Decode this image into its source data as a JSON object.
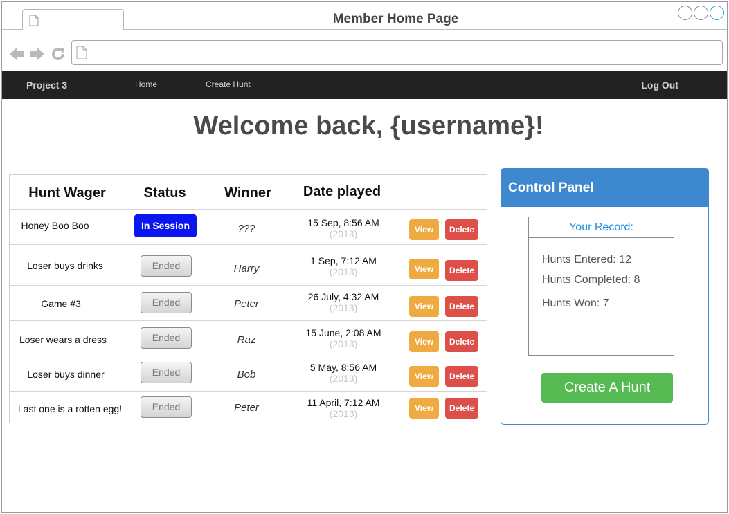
{
  "window": {
    "title": "Member Home Page"
  },
  "navbar": {
    "brand": "Project 3",
    "links": [
      "Home",
      "Create Hunt"
    ],
    "logout": "Log Out"
  },
  "welcome": "Welcome back, {username}!",
  "table": {
    "headers": [
      "Hunt Wager",
      "Status",
      "Winner",
      "Date played"
    ],
    "rows": [
      {
        "wager": "Honey Boo Boo",
        "status": "In Session",
        "winner": "???",
        "date": "15 Sep, 8:56 AM",
        "year": "(2013)"
      },
      {
        "wager": "Loser buys drinks",
        "status": "Ended",
        "winner": "Harry",
        "date": "1 Sep, 7:12 AM",
        "year": "(2013)"
      },
      {
        "wager": "Game #3",
        "status": "Ended",
        "winner": "Peter",
        "date": "26 July, 4:32 AM",
        "year": "(2013)"
      },
      {
        "wager": "Loser wears a dress",
        "status": "Ended",
        "winner": "Raz",
        "date": "15 June, 2:08 AM",
        "year": "(2013)"
      },
      {
        "wager": "Loser buys dinner",
        "status": "Ended",
        "winner": "Bob",
        "date": "5 May, 8:56 AM",
        "year": "(2013)"
      },
      {
        "wager": "Last one is a rotten egg!",
        "status": "Ended",
        "winner": "Peter",
        "date": "11 April, 7:12 AM",
        "year": "(2013)"
      }
    ],
    "view_label": "View",
    "delete_label": "Delete"
  },
  "control_panel": {
    "title": "Control Panel",
    "record_title": "Your Record:",
    "hunts_entered": "Hunts Entered: 12",
    "hunts_completed": "Hunts Completed: 8",
    "hunts_won": "Hunts Won: 7",
    "create_button": "Create A Hunt"
  },
  "colors": {
    "navbar": "#222222",
    "in_session": "#0a16ef",
    "view": "#efab41",
    "delete": "#dc5049",
    "panel": "#3e88d0",
    "create": "#55ba52"
  }
}
